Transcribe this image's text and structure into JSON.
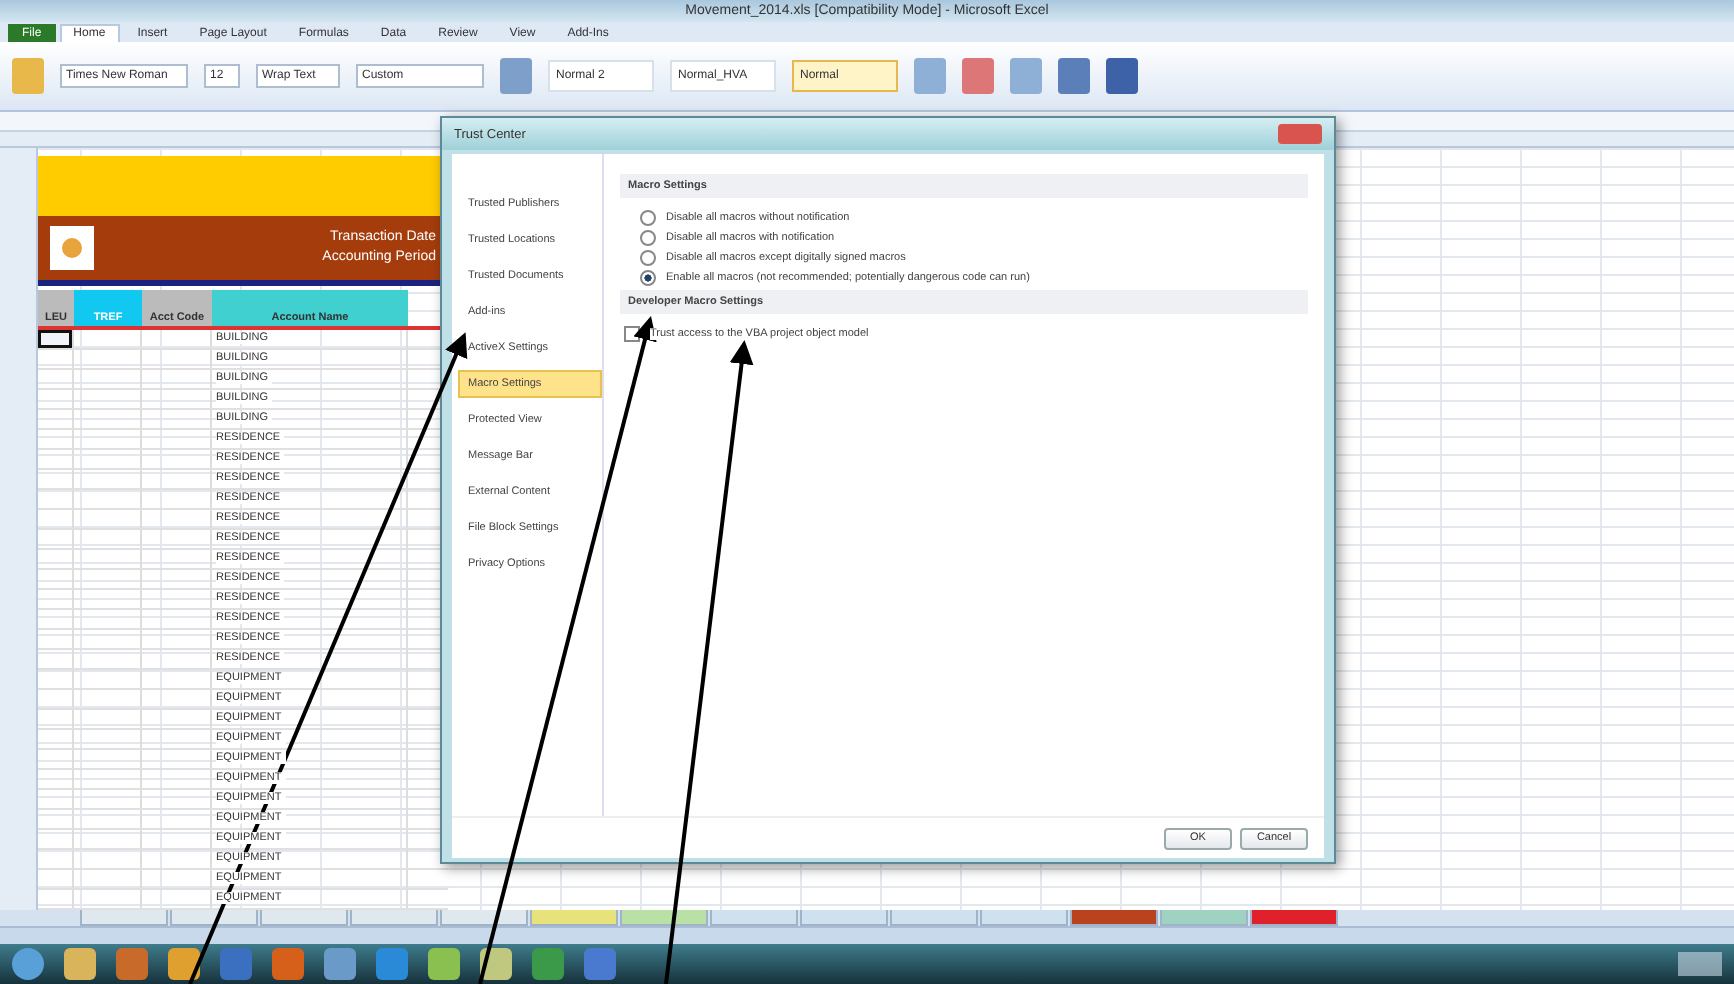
{
  "window": {
    "title": "Movement_2014.xls [Compatibility Mode] - Microsoft Excel"
  },
  "ribbon_tabs": [
    {
      "label": "File",
      "selected": false
    },
    {
      "label": "Home",
      "selected": true
    },
    {
      "label": "Insert",
      "selected": false
    },
    {
      "label": "Page Layout",
      "selected": false
    },
    {
      "label": "Formulas",
      "selected": false
    },
    {
      "label": "Data",
      "selected": false
    },
    {
      "label": "Review",
      "selected": false
    },
    {
      "label": "View",
      "selected": false
    },
    {
      "label": "Add-Ins",
      "selected": false
    }
  ],
  "ribbon": {
    "font_name": "Times New Roman",
    "font_size": "12",
    "wrap": "Wrap Text",
    "number_format": "Custom",
    "styles": [
      {
        "label": "Normal 2",
        "selected": false
      },
      {
        "label": "Normal_HVA",
        "selected": false
      },
      {
        "label": "Normal",
        "selected": true
      }
    ]
  },
  "sheet": {
    "banner_lines": [
      "Transaction Date",
      "Accounting Period"
    ],
    "headers": [
      "LEU",
      "TREF",
      "Acct Code",
      "Account Name"
    ],
    "rows": [
      {
        "account": "BUILDING",
        "selected": true
      },
      {
        "account": "BUILDING",
        "selected": false
      },
      {
        "account": "BUILDING",
        "selected": false
      },
      {
        "account": "BUILDING",
        "selected": false
      },
      {
        "account": "BUILDING",
        "selected": false
      },
      {
        "account": "RESIDENCE",
        "selected": false
      },
      {
        "account": "RESIDENCE",
        "selected": false
      },
      {
        "account": "RESIDENCE",
        "selected": false
      },
      {
        "account": "RESIDENCE",
        "selected": false
      },
      {
        "account": "RESIDENCE",
        "selected": false
      },
      {
        "account": "RESIDENCE",
        "selected": false
      },
      {
        "account": "RESIDENCE",
        "selected": false
      },
      {
        "account": "RESIDENCE",
        "selected": false
      },
      {
        "account": "RESIDENCE",
        "selected": false
      },
      {
        "account": "RESIDENCE",
        "selected": false
      },
      {
        "account": "RESIDENCE",
        "selected": false
      },
      {
        "account": "RESIDENCE",
        "selected": false
      },
      {
        "account": "EQUIPMENT",
        "selected": false
      },
      {
        "account": "EQUIPMENT",
        "selected": false
      },
      {
        "account": "EQUIPMENT",
        "selected": false
      },
      {
        "account": "EQUIPMENT",
        "selected": false
      },
      {
        "account": "EQUIPMENT",
        "selected": false
      },
      {
        "account": "EQUIPMENT",
        "selected": false
      },
      {
        "account": "EQUIPMENT",
        "selected": false
      },
      {
        "account": "EQUIPMENT",
        "selected": false
      },
      {
        "account": "EQUIPMENT",
        "selected": false
      },
      {
        "account": "EQUIPMENT",
        "selected": false
      },
      {
        "account": "EQUIPMENT",
        "selected": false
      },
      {
        "account": "EQUIPMENT",
        "selected": false
      }
    ]
  },
  "dialog": {
    "title": "Trust Center",
    "nav": [
      {
        "label": "Trusted Publishers",
        "selected": false
      },
      {
        "label": "Trusted Locations",
        "selected": false
      },
      {
        "label": "Trusted Documents",
        "selected": false
      },
      {
        "label": "Add-ins",
        "selected": false
      },
      {
        "label": "ActiveX Settings",
        "selected": false
      },
      {
        "label": "Macro Settings",
        "selected": true
      },
      {
        "label": "Protected View",
        "selected": false
      },
      {
        "label": "Message Bar",
        "selected": false
      },
      {
        "label": "External Content",
        "selected": false
      },
      {
        "label": "File Block Settings",
        "selected": false
      },
      {
        "label": "Privacy Options",
        "selected": false
      }
    ],
    "sections": [
      {
        "heading": "Macro Settings",
        "options": [
          {
            "kind": "radio",
            "label": "Disable all macros without notification",
            "checked": false
          },
          {
            "kind": "radio",
            "label": "Disable all macros with notification",
            "checked": false
          },
          {
            "kind": "radio",
            "label": "Disable all macros except digitally signed macros",
            "checked": false
          },
          {
            "kind": "radio",
            "label": "Enable all macros (not recommended; potentially dangerous code can run)",
            "checked": true
          }
        ]
      },
      {
        "heading": "Developer Macro Settings",
        "options": [
          {
            "kind": "checkbox",
            "label": "Trust access to the VBA project object model",
            "checked": false
          }
        ]
      }
    ],
    "buttons": [
      "OK",
      "Cancel"
    ]
  },
  "sheet_tabs": [
    {
      "color": "#dfe8ef"
    },
    {
      "color": "#dfe8ef"
    },
    {
      "color": "#dfe8ef"
    },
    {
      "color": "#dfe8ef"
    },
    {
      "color": "#dfe8ef"
    },
    {
      "color": "#e8e27a"
    },
    {
      "color": "#b9e0a5"
    },
    {
      "color": "#cfe0ef"
    },
    {
      "color": "#cfe0ef"
    },
    {
      "color": "#cfe0ef"
    },
    {
      "color": "#cfe0ef"
    },
    {
      "color": "#b8431e"
    },
    {
      "color": "#9fd2c0"
    },
    {
      "color": "#e0202a"
    }
  ]
}
